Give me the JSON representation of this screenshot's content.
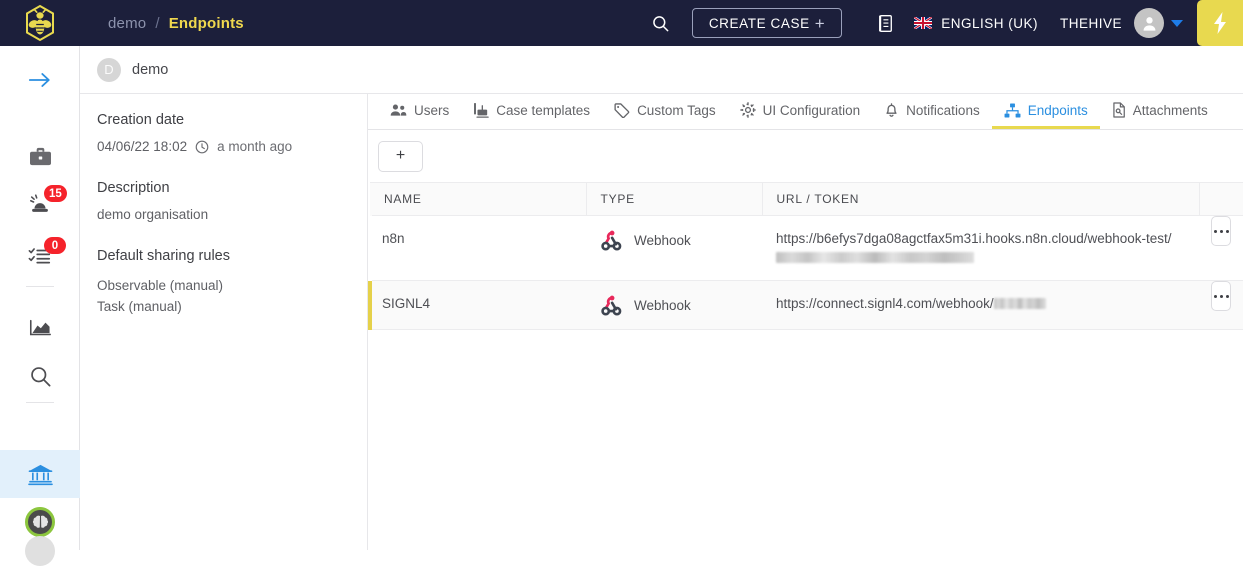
{
  "topbar": {
    "logo_icon": "bee-hexagon-logo",
    "breadcrumb": {
      "parent": "demo",
      "separator": "/",
      "current": "Endpoints"
    },
    "search_icon": "search-icon",
    "create_case_label": "CREATE CASE",
    "create_case_plus": "+",
    "notes_icon": "notes-book-icon",
    "flag_icon": "uk-flag-icon",
    "language": "ENGLISH (UK)",
    "user": "THEHIVE",
    "avatar_icon": "user-avatar-icon",
    "caret_icon": "chevron-down-icon",
    "bolt_icon": "lightning-bolt-icon",
    "colors": {
      "background": "#1c1f3b",
      "accent_yellow": "#e8d94f",
      "accent_blue": "#1e7ce8"
    }
  },
  "rail": {
    "items": [
      {
        "name": "expand-sidebar",
        "icon": "arrow-right-icon",
        "badge": null,
        "active": false
      },
      {
        "name": "cases",
        "icon": "briefcase-icon",
        "badge": null,
        "active": false
      },
      {
        "name": "alerts",
        "icon": "siren-alert-icon",
        "badge": "15",
        "active": false
      },
      {
        "name": "tasks",
        "icon": "task-list-icon",
        "badge": "0",
        "active": false
      },
      {
        "name": "dashboards",
        "icon": "chart-icon",
        "badge": null,
        "active": false
      },
      {
        "name": "search",
        "icon": "search-icon",
        "badge": null,
        "active": false
      },
      {
        "name": "organisation",
        "icon": "bank-organisation-icon",
        "badge": null,
        "active": true
      },
      {
        "name": "cortex",
        "icon": "brain-icon",
        "badge": null,
        "active": false
      }
    ],
    "badge_color": "#f5232b",
    "active_bg": "#e2f0fb"
  },
  "org_header": {
    "avatar_letter": "D",
    "name": "demo"
  },
  "detail_panel": {
    "creation_date_label": "Creation date",
    "creation_date_value": "04/06/22 18:02",
    "creation_date_relative": "a month ago",
    "clock_icon": "clock-icon",
    "description_label": "Description",
    "description_value": "demo organisation",
    "sharing_label": "Default sharing rules",
    "sharing_rules": [
      "Observable (manual)",
      "Task (manual)"
    ]
  },
  "tabs": [
    {
      "label": "Users",
      "icon": "users-icon",
      "active": false
    },
    {
      "label": "Case templates",
      "icon": "case-template-icon",
      "active": false
    },
    {
      "label": "Custom Tags",
      "icon": "tag-icon",
      "active": false
    },
    {
      "label": "UI Configuration",
      "icon": "gear-icon",
      "active": false
    },
    {
      "label": "Notifications",
      "icon": "bell-icon",
      "active": false
    },
    {
      "label": "Endpoints",
      "icon": "sitemap-icon",
      "active": true
    },
    {
      "label": "Attachments",
      "icon": "file-icon",
      "active": false
    }
  ],
  "toolbar": {
    "add_label": "+"
  },
  "table": {
    "headers": [
      "NAME",
      "TYPE",
      "URL / TOKEN",
      ""
    ],
    "rows": [
      {
        "name": "n8n",
        "type": "Webhook",
        "type_icon": "webhook-icon",
        "url": "https://b6efys7dga08agctfax5m31i.hooks.n8n.cloud/webhook-test/",
        "url_redacted": true,
        "actions_icon": "ellipsis-icon",
        "highlighted": false
      },
      {
        "name": "SIGNL4",
        "type": "Webhook",
        "type_icon": "webhook-icon",
        "url": "https://connect.signl4.com/webhook/",
        "url_redacted": true,
        "actions_icon": "ellipsis-icon",
        "highlighted": true
      }
    ],
    "highlight_color": "#e5d14a"
  }
}
